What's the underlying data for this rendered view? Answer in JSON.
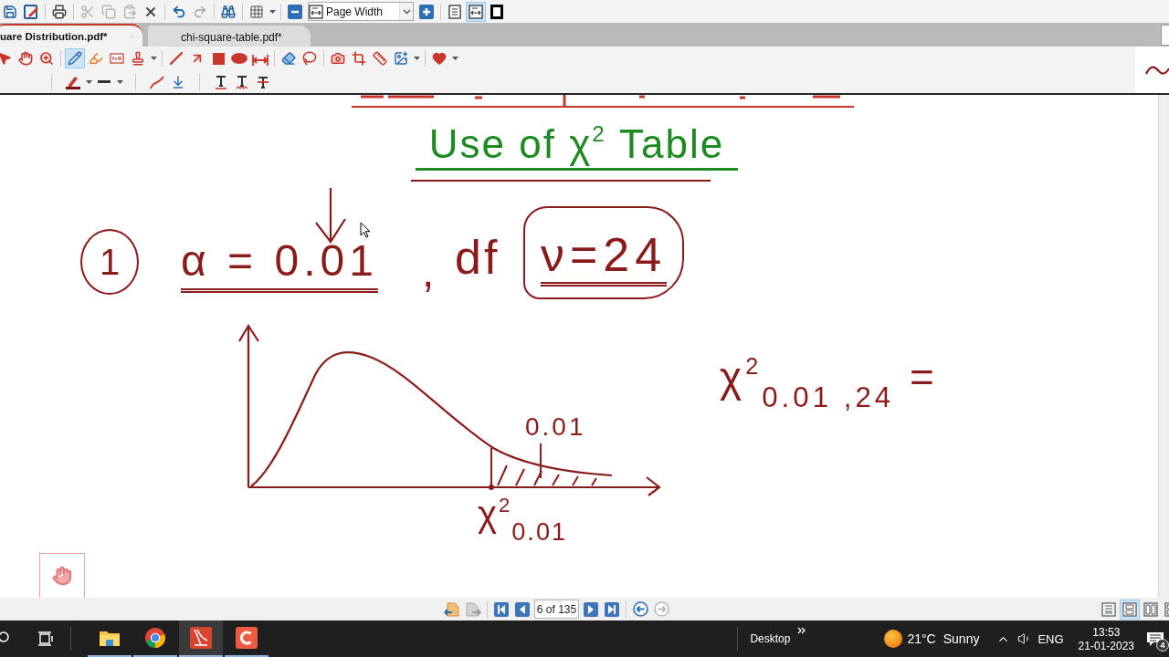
{
  "toolbar": {
    "buttons": [
      {
        "kind": "save",
        "disabled": false
      },
      {
        "kind": "save-as",
        "disabled": false
      },
      {
        "kind": "print",
        "disabled": false
      },
      {
        "kind": "cut",
        "disabled": true
      },
      {
        "kind": "copy",
        "disabled": true
      },
      {
        "kind": "paste",
        "disabled": true
      },
      {
        "kind": "delete",
        "disabled": false
      },
      {
        "kind": "undo",
        "disabled": false
      },
      {
        "kind": "redo",
        "disabled": true
      },
      {
        "kind": "find",
        "disabled": false
      },
      {
        "kind": "grid",
        "disabled": false
      }
    ],
    "zoom": {
      "value": "Page Width"
    },
    "view_modes": [
      {
        "kind": "actual-size",
        "selected": false
      },
      {
        "kind": "fit-width",
        "selected": true
      },
      {
        "kind": "full-screen",
        "selected": false
      }
    ]
  },
  "tabs": [
    {
      "label": "uare Distribution.pdf*",
      "selected": true
    },
    {
      "label": "chi-square-table.pdf*",
      "selected": false
    }
  ],
  "annotation_tools": [
    {
      "kind": "select",
      "selected": false
    },
    {
      "kind": "hand",
      "selected": false
    },
    {
      "kind": "zoom",
      "selected": false
    },
    {
      "kind": "pencil",
      "selected": true
    },
    {
      "kind": "highlighter",
      "selected": false
    },
    {
      "kind": "textbox",
      "selected": false
    },
    {
      "kind": "stamp",
      "selected": false
    },
    {
      "kind": "line",
      "selected": false
    },
    {
      "kind": "arrow",
      "selected": false
    },
    {
      "kind": "rectangle",
      "selected": false
    },
    {
      "kind": "ellipse",
      "selected": false
    },
    {
      "kind": "distance",
      "selected": false
    },
    {
      "kind": "eraser",
      "selected": false
    },
    {
      "kind": "lasso",
      "selected": false
    },
    {
      "kind": "snapshot",
      "selected": false
    },
    {
      "kind": "crop",
      "selected": false
    },
    {
      "kind": "measure",
      "selected": false
    },
    {
      "kind": "image",
      "selected": false
    },
    {
      "kind": "favorite",
      "selected": false
    }
  ],
  "document": {
    "title": "Use of χ$^{2}$ Table",
    "problem": {
      "number": "1",
      "alpha": "α = 0.01",
      "separator": ",",
      "df_label": "df",
      "df_value": "ν=24"
    },
    "sketch": {
      "tail_label": "0.01",
      "critical_label": "χ$^{2}$$_{0.01}$"
    },
    "result": "χ$^{2}$$_{0.01 ,24}$ ="
  },
  "navigation": {
    "buttons": [
      {
        "kind": "previous-document",
        "disabled": false
      },
      {
        "kind": "next-document",
        "disabled": true
      },
      {
        "kind": "first",
        "disabled": false
      },
      {
        "kind": "previous",
        "disabled": false
      },
      {
        "kind": "next",
        "disabled": false
      },
      {
        "kind": "last",
        "disabled": false
      },
      {
        "kind": "back",
        "disabled": false
      },
      {
        "kind": "forward",
        "disabled": true
      }
    ],
    "page_field": {
      "value": "6 of 135"
    },
    "view_modes": [
      {
        "kind": "single",
        "selected": false
      },
      {
        "kind": "continuous",
        "selected": true
      },
      {
        "kind": "facing",
        "selected": false
      },
      {
        "kind": "facing-continuous",
        "selected": false
      }
    ]
  },
  "taskbar": {
    "apps": [
      {
        "kind": "file-explorer",
        "selected": false
      },
      {
        "kind": "browser",
        "selected": false
      },
      {
        "kind": "pdf-editor",
        "selected": true
      },
      {
        "kind": "recorder",
        "selected": false
      }
    ],
    "desktop": "Desktop",
    "weather": {
      "temperature": "21°C",
      "condition": "Sunny"
    },
    "language": "ENG",
    "time": "13:53",
    "date": "21-01-2023",
    "notifications": "4"
  }
}
